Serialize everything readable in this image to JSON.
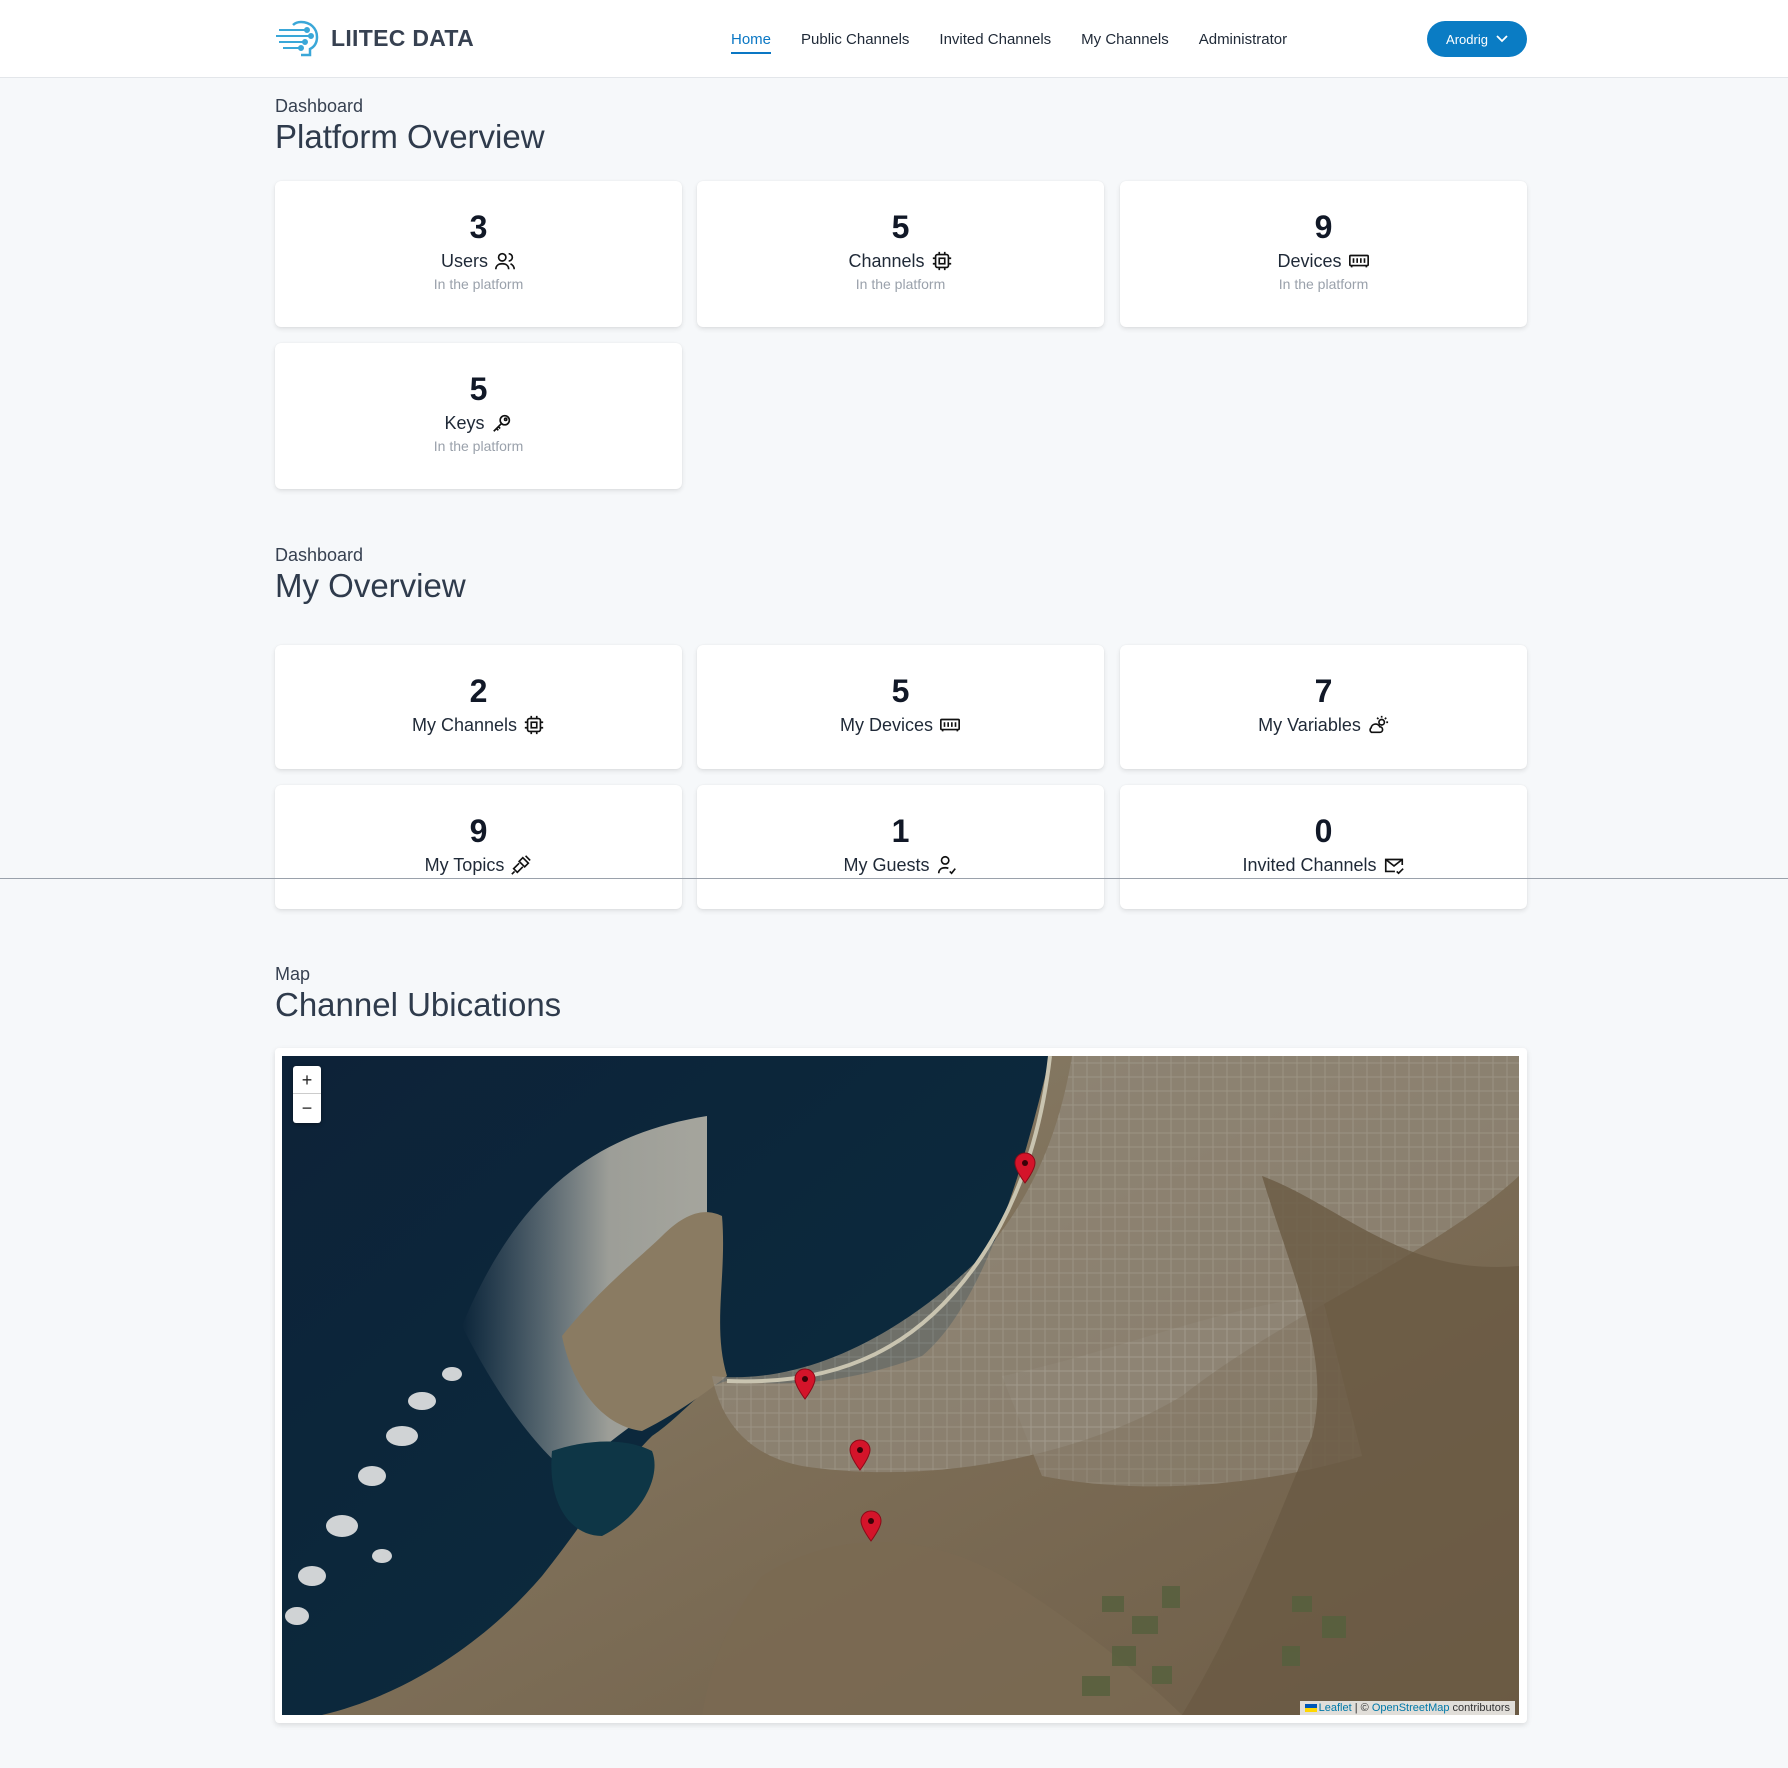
{
  "header": {
    "brand": "LIITEC DATA",
    "nav": [
      "Home",
      "Public Channels",
      "Invited Channels",
      "My Channels",
      "Administrator"
    ],
    "active_nav": "Home",
    "user": "Arodrig"
  },
  "platform": {
    "eyebrow": "Dashboard",
    "title": "Platform Overview",
    "cards": [
      {
        "value": "3",
        "label": "Users",
        "sub": "In the platform",
        "icon": "users-icon"
      },
      {
        "value": "5",
        "label": "Channels",
        "sub": "In the platform",
        "icon": "chip-icon"
      },
      {
        "value": "9",
        "label": "Devices",
        "sub": "In the platform",
        "icon": "memory-icon"
      },
      {
        "value": "5",
        "label": "Keys",
        "sub": "In the platform",
        "icon": "key-icon"
      }
    ]
  },
  "mine": {
    "eyebrow": "Dashboard",
    "title": "My Overview",
    "cards": [
      {
        "value": "2",
        "label": "My Channels",
        "icon": "chip-icon"
      },
      {
        "value": "5",
        "label": "My Devices",
        "icon": "memory-icon"
      },
      {
        "value": "7",
        "label": "My Variables",
        "icon": "weather-icon"
      },
      {
        "value": "9",
        "label": "My Topics",
        "icon": "plug-icon"
      },
      {
        "value": "1",
        "label": "My Guests",
        "icon": "user-check-icon"
      },
      {
        "value": "0",
        "label": "Invited Channels",
        "icon": "mail-check-icon"
      }
    ]
  },
  "map": {
    "eyebrow": "Map",
    "title": "Channel Ubications",
    "zoom_in": "+",
    "zoom_out": "−",
    "attribution": {
      "leaflet": "Leaflet",
      "sep": " | © ",
      "osm": "OpenStreetMap",
      "tail": " contributors"
    }
  },
  "colors": {
    "accent": "#0a7cc4",
    "marker": "#d4142a"
  }
}
